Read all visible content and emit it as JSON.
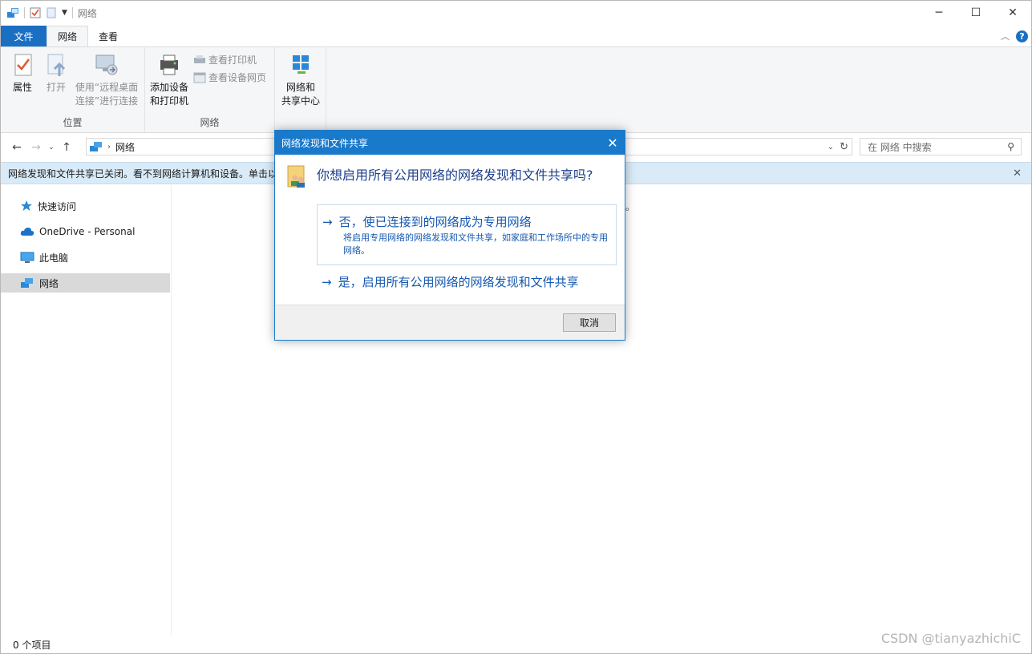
{
  "window": {
    "title": "网络"
  },
  "ribbon": {
    "tabs": [
      "文件",
      "网络",
      "查看"
    ],
    "groups": {
      "location": {
        "label": "位置",
        "properties": "属性",
        "open": "打开",
        "remote_line1": "使用“远程桌面",
        "remote_line2": "连接”进行连接"
      },
      "network": {
        "label": "网络",
        "add_line1": "添加设备",
        "add_line2": "和打印机",
        "view_printers": "查看打印机",
        "view_device_page": "查看设备网页",
        "center_line1": "网络和",
        "center_line2": "共享中心"
      }
    }
  },
  "address": {
    "path": "网络",
    "search_placeholder": "在 网络 中搜索"
  },
  "infobar": {
    "text": "网络发现和文件共享已关闭。看不到网络计算机和设备。单击以"
  },
  "navpane": {
    "items": [
      {
        "label": "快速访问",
        "icon": "pin-star-icon"
      },
      {
        "label": "OneDrive - Personal",
        "icon": "cloud-icon"
      },
      {
        "label": "此电脑",
        "icon": "monitor-icon"
      },
      {
        "label": "网络",
        "icon": "network-icon"
      }
    ]
  },
  "content": {
    "fragment": "。"
  },
  "status": {
    "item_count": "0 个项目"
  },
  "watermark": "CSDN @tianyazhichiC",
  "dialog": {
    "title": "网络发现和文件共享",
    "question": "你想启用所有公用网络的网络发现和文件共享吗?",
    "option_private": {
      "label": "否，使已连接到的网络成为专用网络",
      "description": "将启用专用网络的网络发现和文件共享，如家庭和工作场所中的专用网络。"
    },
    "option_public": {
      "label": "是，启用所有公用网络的网络发现和文件共享"
    },
    "cancel": "取消"
  },
  "colors": {
    "accent": "#1979ca",
    "link": "#1559b0",
    "infobar": "#d9ebf8"
  }
}
